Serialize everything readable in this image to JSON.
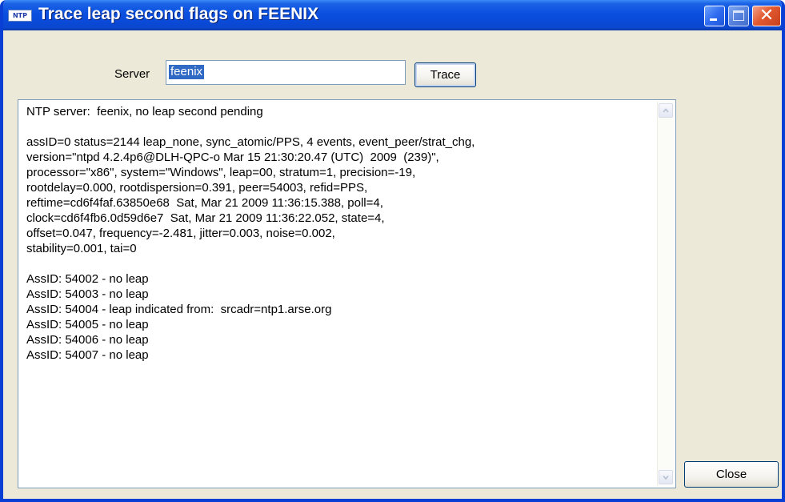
{
  "window": {
    "app_icon_label": "NTP",
    "title": "Trace leap second flags on FEENIX",
    "close_glyph": "✕"
  },
  "form": {
    "server_label": "Server",
    "server_value": "feenix",
    "trace_label": "Trace"
  },
  "output": {
    "lines": [
      "NTP server:  feenix, no leap second pending",
      "",
      "assID=0 status=2144 leap_none, sync_atomic/PPS, 4 events, event_peer/strat_chg,",
      "version=\"ntpd 4.2.4p6@DLH-QPC-o Mar 15 21:30:20.47 (UTC)  2009  (239)\",",
      "processor=\"x86\", system=\"Windows\", leap=00, stratum=1, precision=-19,",
      "rootdelay=0.000, rootdispersion=0.391, peer=54003, refid=PPS,",
      "reftime=cd6f4faf.63850e68  Sat, Mar 21 2009 11:36:15.388, poll=4,",
      "clock=cd6f4fb6.0d59d6e7  Sat, Mar 21 2009 11:36:22.052, state=4,",
      "offset=0.047, frequency=-2.481, jitter=0.003, noise=0.002,",
      "stability=0.001, tai=0",
      "",
      "AssID: 54002 - no leap",
      "AssID: 54003 - no leap",
      "AssID: 54004 - leap indicated from:  srcadr=ntp1.arse.org",
      "AssID: 54005 - no leap",
      "AssID: 54006 - no leap",
      "AssID: 54007 - no leap"
    ]
  },
  "footer": {
    "close_label": "Close"
  },
  "colors": {
    "titlebar": "#0a4fdf",
    "dialog_bg": "#ece9d8",
    "selection": "#316ac5",
    "close_button": "#e2582f"
  },
  "icons": {
    "app": "ntp-app-icon",
    "minimize": "minimize-icon",
    "maximize": "maximize-icon",
    "close": "close-icon",
    "scroll_up": "chevron-up-icon",
    "scroll_down": "chevron-down-icon"
  }
}
